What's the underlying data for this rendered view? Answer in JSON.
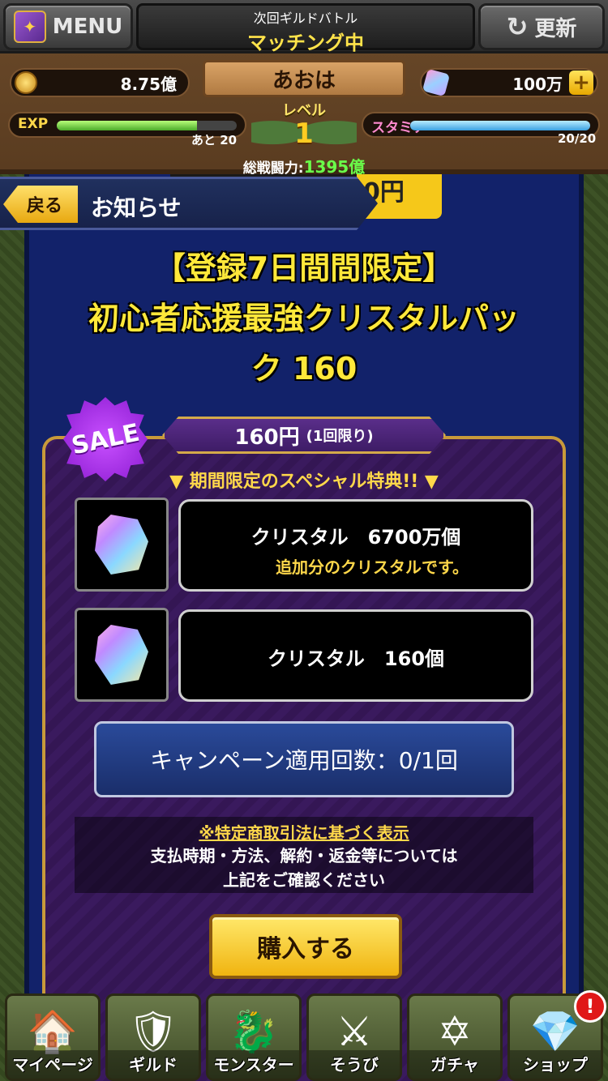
{
  "header": {
    "menu_label": "MENU",
    "guild_battle_label": "次回ギルドバトル",
    "guild_status": "マッチング中",
    "refresh_label": "更新",
    "gold": "8.75億",
    "player_name": "あおは",
    "crystals": "100万",
    "level_label": "レベル",
    "level": "1",
    "exp_label": "EXP",
    "exp_remaining": "あと 20",
    "exp_progress": 0.78,
    "stamina_label": "スタミナ",
    "stamina_value": "20/20",
    "stamina_progress": 1.0,
    "power_label": "総戦闘力:",
    "power_value": "1395億"
  },
  "notice": {
    "back_label": "戻る",
    "title": "お知らせ",
    "behind_price": "0円"
  },
  "offer": {
    "headline_line1": "【登録7日間間限定】",
    "headline_line2": "初心者応援最強クリスタルパッ",
    "headline_line3": "ク 160",
    "sale_badge": "SALE",
    "price": "160円",
    "price_note": "(1回限り)",
    "special_label": "▼ 期間限定のスペシャル特典!! ▼",
    "items": [
      {
        "name": "クリスタル　6700万個",
        "desc": "追加分のクリスタルです。"
      },
      {
        "name": "クリスタル　160個",
        "desc": ""
      }
    ],
    "campaign": "キャンペーン適用回数：0/1回",
    "legal_link": "※特定商取引法に基づく表示",
    "legal_line1": "支払時期・方法、解約・返金等については",
    "legal_line2": "上記をご確認ください",
    "buy_label": "購入する"
  },
  "nav": [
    {
      "label": "マイページ",
      "icon": "house-icon"
    },
    {
      "label": "ギルド",
      "icon": "shield-icon"
    },
    {
      "label": "モンスター",
      "icon": "dragon-icon"
    },
    {
      "label": "そうび",
      "icon": "sword-icon"
    },
    {
      "label": "ガチャ",
      "icon": "magic-circle-icon"
    },
    {
      "label": "ショップ",
      "icon": "crystal-chest-icon",
      "badge": "!"
    }
  ]
}
